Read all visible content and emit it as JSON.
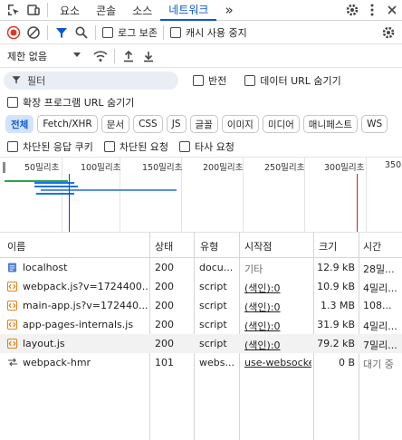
{
  "tabs": {
    "elements": "요소",
    "console": "콘솔",
    "sources": "소스",
    "network": "네트워크",
    "more": "»"
  },
  "toolbar": {
    "preserve_log": "로그 보존",
    "disable_cache": "캐시 사용 중지"
  },
  "throttle": {
    "value": "제한 없음"
  },
  "filter": {
    "placeholder": "필터",
    "invert": "반전",
    "hide_data_urls": "데이터 URL 숨기기",
    "hide_ext_urls": "확장 프로그램 URL 숨기기"
  },
  "chips": [
    "전체",
    "Fetch/XHR",
    "문서",
    "CSS",
    "JS",
    "글꼴",
    "이미지",
    "미디어",
    "매니페스트",
    "WS"
  ],
  "blocking": {
    "blocked_cookies": "차단된 응답 쿠키",
    "blocked_requests": "차단된 요청",
    "third_party": "타사 요청"
  },
  "timeline": {
    "ticks": [
      "50밀리초",
      "100밀리초",
      "150밀리초",
      "200밀리초",
      "250밀리초",
      "300밀리초",
      "350"
    ]
  },
  "columns": {
    "name": "이름",
    "status": "상태",
    "type": "유형",
    "initiator": "시작점",
    "size": "크기",
    "time": "시간"
  },
  "rows": [
    {
      "icon": "document-icon",
      "name": "localhost",
      "status": "200",
      "type": "docu...",
      "initiator": "기타",
      "init_link": false,
      "size": "12.9 kB",
      "time": "28밀..."
    },
    {
      "icon": "script-icon",
      "name": "webpack.js?v=1724400...",
      "status": "200",
      "type": "script",
      "initiator": "(색인):0",
      "init_link": true,
      "size": "10.9 kB",
      "time": "4밀리..."
    },
    {
      "icon": "script-icon",
      "name": "main-app.js?v=172440...",
      "status": "200",
      "type": "script",
      "initiator": "(색인):0",
      "init_link": true,
      "size": "1.3 MB",
      "time": "108..."
    },
    {
      "icon": "script-icon",
      "name": "app-pages-internals.js",
      "status": "200",
      "type": "script",
      "initiator": "(색인):0",
      "init_link": true,
      "size": "31.9 kB",
      "time": "4밀리..."
    },
    {
      "icon": "script-icon",
      "name": "layout.js",
      "status": "200",
      "type": "script",
      "initiator": "(색인):0",
      "init_link": true,
      "size": "79.2 kB",
      "time": "7밀리..."
    },
    {
      "icon": "websocket-icon",
      "name": "webpack-hmr",
      "status": "101",
      "type": "webs...",
      "initiator": "use-websocke",
      "init_link": true,
      "size": "0 B",
      "time": "대기 중"
    }
  ]
}
